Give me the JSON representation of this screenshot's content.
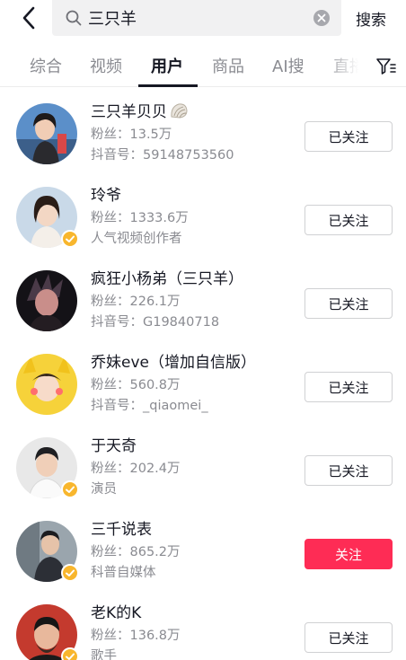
{
  "search": {
    "query": "三只羊",
    "button_label": "搜索"
  },
  "tabs": [
    {
      "label": "综合"
    },
    {
      "label": "视频"
    },
    {
      "label": "用户"
    },
    {
      "label": "商品"
    },
    {
      "label": "AI搜"
    },
    {
      "label": "直播"
    }
  ],
  "active_tab": "用户",
  "users": [
    {
      "name": "三只羊贝贝",
      "fans": "粉丝：13.5万",
      "sub": "抖音号：59148753560",
      "button": "已关注",
      "verified": false
    },
    {
      "name": "玲爷",
      "fans": "粉丝：1333.6万",
      "sub": "人气视频创作者",
      "button": "已关注",
      "verified": true
    },
    {
      "name": "疯狂小杨弟（三只羊）",
      "fans": "粉丝：226.1万",
      "sub": "抖音号：G19840718",
      "button": "已关注",
      "verified": false
    },
    {
      "name": "乔妹eve（增加自信版）",
      "fans": "粉丝：560.8万",
      "sub": "抖音号：_qiaomei_",
      "button": "已关注",
      "verified": false
    },
    {
      "name": "于天奇",
      "fans": "粉丝：202.4万",
      "sub": "演员",
      "button": "已关注",
      "verified": true
    },
    {
      "name": "三千说表",
      "fans": "粉丝：865.2万",
      "sub": "科普自媒体",
      "button": "关注",
      "verified": true
    },
    {
      "name": "老K的K",
      "fans": "粉丝：136.8万",
      "sub": "歌手",
      "button": "已关注",
      "verified": true
    }
  ],
  "colors": {
    "accent": "#fe2c55",
    "verified_badge": "#f8b62d",
    "secondary_text": "#8a8b91"
  },
  "icons": {
    "back": "back-arrow-icon",
    "search": "search-icon",
    "clear": "clear-icon",
    "filter": "filter-icon",
    "verified": "verified-badge-icon",
    "shell": "shell-emoji-icon"
  }
}
